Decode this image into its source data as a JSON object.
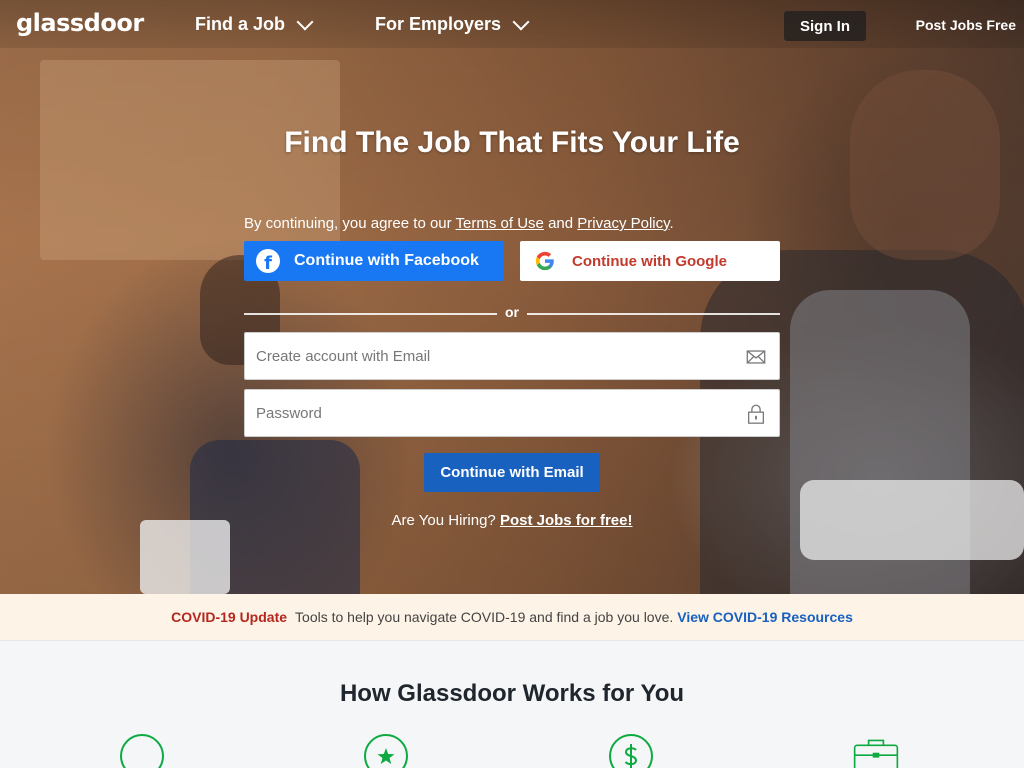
{
  "header": {
    "logo": "glassdoor",
    "nav": [
      {
        "label": "Find a Job"
      },
      {
        "label": "For Employers"
      }
    ],
    "signin_label": "Sign In",
    "post_jobs_label": "Post Jobs Free"
  },
  "hero": {
    "headline": "Find The Job That Fits Your Life",
    "terms_prefix": "By continuing, you agree to our",
    "terms_link": "Terms of Use",
    "terms_and": "and",
    "privacy_link": "Privacy Policy",
    "terms_suffix": ".",
    "facebook_label": "Continue with Facebook",
    "google_label": "Continue with Google",
    "or_label": "or",
    "email_placeholder": "Create account with Email",
    "password_placeholder": "Password",
    "continue_email_label": "Continue with Email",
    "hiring_text": "Are You Hiring?",
    "hiring_link": "Post Jobs for free!"
  },
  "covid": {
    "tag": "COVID-19 Update",
    "text": "Tools to help you navigate COVID-19 and find a job you love.",
    "link": "View COVID-19 Resources"
  },
  "how": {
    "title": "How Glassdoor Works for You",
    "icons": [
      "circle-icon",
      "star-icon",
      "dollar-icon",
      "briefcase-icon"
    ]
  },
  "colors": {
    "facebook": "#1877f2",
    "google_text": "#c33a2c",
    "primary_button": "#1861bf",
    "covid_tag": "#b4281e",
    "covid_bg": "#fdf3e7",
    "icon_green": "#0caa41"
  }
}
